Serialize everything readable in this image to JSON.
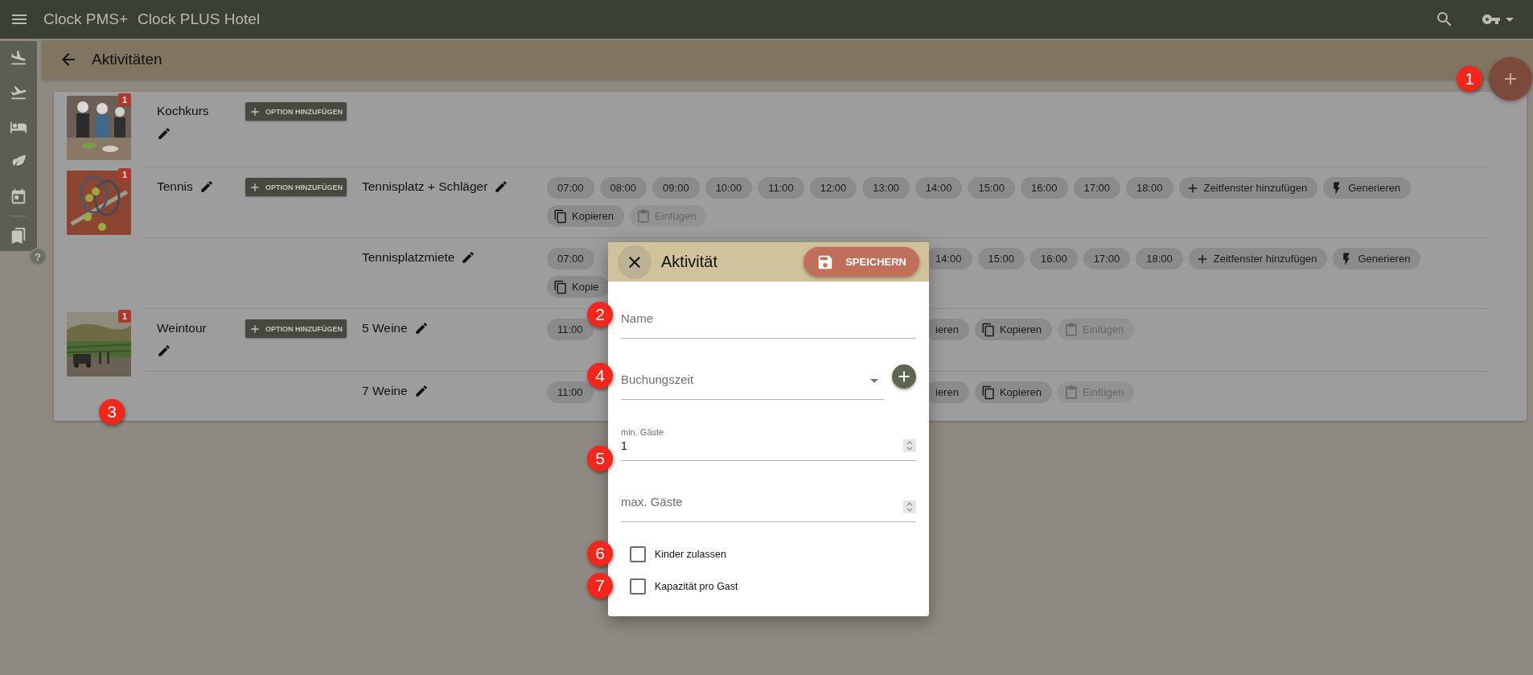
{
  "app_bar": {
    "brand": "Clock PMS+",
    "hotel": "Clock PLUS Hotel"
  },
  "sidebar": {
    "help": "?"
  },
  "page": {
    "title": "Aktivitäten"
  },
  "fab": {
    "callout": "1"
  },
  "card": {
    "callout": "3"
  },
  "activities": [
    {
      "name": "Kochkurs",
      "badge": "1",
      "button": "OPTION HINZUFÜGEN"
    },
    {
      "name": "Tennis",
      "badge": "1",
      "button": "OPTION HINZUFÜGEN",
      "options": [
        {
          "name": "Tennisplatz + Schläger",
          "lines": [
            {
              "chips": [
                {
                  "kind": "time",
                  "text": "07:00",
                  "disabled": false
                },
                {
                  "kind": "time",
                  "text": "08:00",
                  "disabled": false
                },
                {
                  "kind": "time",
                  "text": "09:00",
                  "disabled": false
                },
                {
                  "kind": "time",
                  "text": "10:00",
                  "disabled": false
                },
                {
                  "kind": "time",
                  "text": "11:00",
                  "disabled": false
                },
                {
                  "kind": "time",
                  "text": "12:00",
                  "disabled": false
                },
                {
                  "kind": "time",
                  "text": "13:00",
                  "disabled": false
                },
                {
                  "kind": "time",
                  "text": "14:00",
                  "disabled": false
                },
                {
                  "kind": "time",
                  "text": "15:00",
                  "disabled": false
                },
                {
                  "kind": "time",
                  "text": "16:00",
                  "disabled": false
                },
                {
                  "kind": "time",
                  "text": "17:00",
                  "disabled": false
                },
                {
                  "kind": "time",
                  "text": "18:00",
                  "disabled": false
                },
                {
                  "kind": "add",
                  "text": "Zeitfenster hinzufügen",
                  "disabled": false
                },
                {
                  "kind": "generate",
                  "text": "Generieren",
                  "disabled": false
                }
              ]
            },
            {
              "chips": [
                {
                  "kind": "copy",
                  "text": "Kopieren",
                  "disabled": false
                },
                {
                  "kind": "paste",
                  "text": "Einfügen",
                  "disabled": true
                }
              ]
            }
          ]
        },
        {
          "name": "Tennisplatzmiete",
          "lines": [
            {
              "chips": [
                {
                  "kind": "time",
                  "text": "07:00",
                  "disabled": false
                }
              ],
              "chips_right": [
                {
                  "kind": "time",
                  "text": "14:00",
                  "disabled": false
                },
                {
                  "kind": "time",
                  "text": "15:00",
                  "disabled": false
                },
                {
                  "kind": "time",
                  "text": "16:00",
                  "disabled": false
                },
                {
                  "kind": "time",
                  "text": "17:00",
                  "disabled": false
                },
                {
                  "kind": "time",
                  "text": "18:00",
                  "disabled": false
                },
                {
                  "kind": "add",
                  "text": "Zeitfenster hinzufügen",
                  "disabled": false
                },
                {
                  "kind": "generate",
                  "text": "Generieren",
                  "disabled": false
                }
              ]
            },
            {
              "chips": [
                {
                  "kind": "copy",
                  "text": "Kopie",
                  "disabled": false
                }
              ]
            }
          ]
        }
      ]
    },
    {
      "name": "Weintour",
      "badge": "1",
      "button": "OPTION HINZUFÜGEN",
      "options": [
        {
          "name": "5 Weine",
          "lines": [
            {
              "chips": [
                {
                  "kind": "time",
                  "text": "11:00",
                  "disabled": false
                }
              ],
              "chips_right": [
                {
                  "kind": "text",
                  "text": "ieren",
                  "disabled": false
                },
                {
                  "kind": "copy",
                  "text": "Kopieren",
                  "disabled": false
                },
                {
                  "kind": "paste",
                  "text": "Einfügen",
                  "disabled": true
                }
              ]
            }
          ]
        },
        {
          "name": "7 Weine",
          "lines": [
            {
              "chips": [
                {
                  "kind": "time",
                  "text": "11:00",
                  "disabled": false
                }
              ],
              "chips_right": [
                {
                  "kind": "text",
                  "text": "ieren",
                  "disabled": false
                },
                {
                  "kind": "copy",
                  "text": "Kopieren",
                  "disabled": false
                },
                {
                  "kind": "paste",
                  "text": "Einfügen",
                  "disabled": true
                }
              ]
            }
          ]
        }
      ]
    }
  ],
  "dialog": {
    "title": "Aktivität",
    "save": "SPEICHERN",
    "fields": [
      {
        "kind": "text",
        "label": "Name",
        "callout": "2"
      },
      {
        "kind": "select",
        "label": "Buchungszeit",
        "callout": "4"
      },
      {
        "kind": "number",
        "label": "min. Gäste",
        "value": "1",
        "callout": "5"
      },
      {
        "kind": "number",
        "label": "max. Gäste"
      }
    ],
    "checkboxes": [
      {
        "label": "Kinder zulassen",
        "checked": false,
        "callout": "6"
      },
      {
        "label": "Kapazität pro Gast",
        "checked": false,
        "callout": "7"
      }
    ]
  }
}
